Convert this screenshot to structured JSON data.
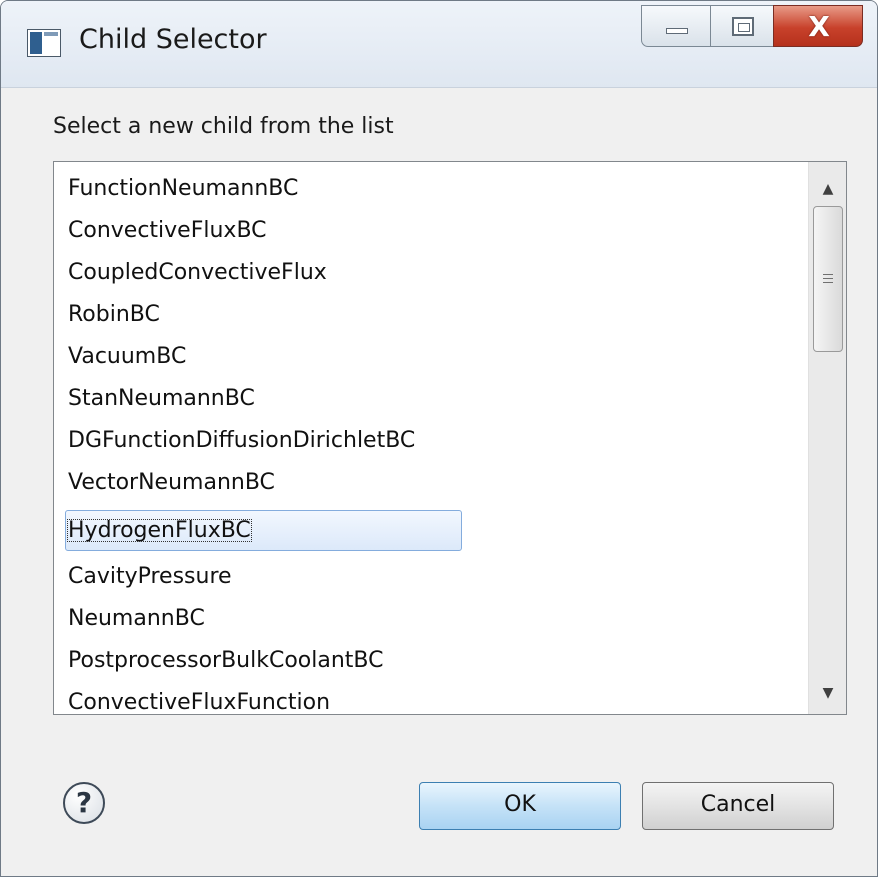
{
  "window": {
    "title": "Child Selector",
    "close_glyph": "X"
  },
  "dialog": {
    "instruction": "Select a new child from the list",
    "selected_item": "HydrogenFluxBC"
  },
  "list": {
    "items": [
      "FunctionNeumannBC",
      "ConvectiveFluxBC",
      "CoupledConvectiveFlux",
      "RobinBC",
      "VacuumBC",
      "StanNeumannBC",
      "DGFunctionDiffusionDirichletBC",
      "VectorNeumannBC",
      "HydrogenFluxBC",
      "CavityPressure",
      "NeumannBC",
      "PostprocessorBulkCoolantBC",
      "ConvectiveFluxFunction"
    ]
  },
  "scrollbar": {
    "up_arrow": "▲",
    "down_arrow": "▼"
  },
  "footer": {
    "help_glyph": "?",
    "ok_label": "OK",
    "cancel_label": "Cancel"
  },
  "icons": {
    "app": "window-app-icon",
    "minimize": "minimize-icon",
    "maximize": "maximize-icon",
    "close": "close-icon",
    "help": "help-icon"
  },
  "colors": {
    "selection_fill": "#dce9fa",
    "selection_border": "#84acdd",
    "close_button": "#c8412b",
    "ok_button": "#c5e2f7"
  }
}
